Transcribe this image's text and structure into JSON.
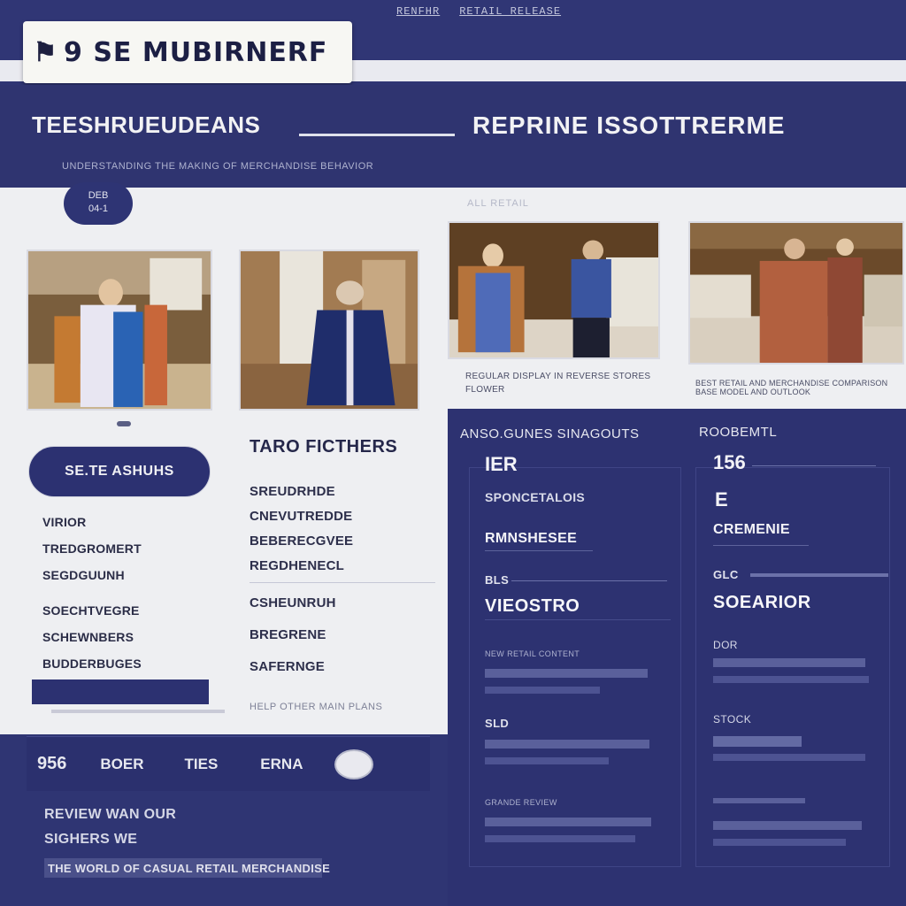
{
  "header": {
    "top_links": [
      "RENFHR",
      "RETAIL RELEASE"
    ],
    "logo_text": "9 SE MUBIRNERF"
  },
  "hero": {
    "title_left": "TEESHRUEUDEANS",
    "title_right": "REPRINE ISSOTTRERME",
    "subtitle": "UNDERSTANDING THE MAKING OF MERCHANDISE BEHAVIOR"
  },
  "date_badge": {
    "line1": "DEB",
    "line2": "04-1"
  },
  "panel_caption": "ALL RETAIL",
  "photos": [
    {
      "caption": ""
    },
    {
      "caption": ""
    },
    {
      "caption_line1": "REGULAR DISPLAY IN REVERSE STORES",
      "caption_line2": "FLOWER"
    },
    {
      "caption": "BEST RETAIL AND MERCHANDISE COMPARISON BASE MODEL AND OUTLOOK"
    }
  ],
  "left_card": {
    "button_label": "SE.TE ASHUHS",
    "items": [
      "VIRIOR",
      "TREDGROMERT",
      "SEGDGUUNH",
      "SOECHTVEGRE",
      "SCHEWNBERS",
      "BUDDERBUGES"
    ]
  },
  "mid_col": {
    "title": "TARO FICTHERS",
    "items": [
      "SREUDRHDE",
      "CNEVUTREDDE",
      "BEBERECGVEE",
      "REGDHENECL",
      "CSHEUNRUH",
      "BREGRENE",
      "SAFERNGE"
    ],
    "footer": "HELP OTHER MAIN PLANS"
  },
  "right_col_a": {
    "heading": "ANSO.GUNES SINAGOUTS",
    "big": "IER",
    "line1": "SPONCETALOIS",
    "line2": "RMNSHESEE",
    "tiny1": "BLS",
    "bold": "VIEOSTRO",
    "tiny2": "NEW RETAIL CONTENT",
    "tiny3": "SLD",
    "tiny4": "GRANDE REVIEW"
  },
  "right_col_b": {
    "heading": "ROOBEMTL",
    "big": "156",
    "big2": "E",
    "line1": "CREMENIE",
    "tiny1": "GLC",
    "bold": "SOEARIOR",
    "tiny2": "DOR",
    "tiny3": "STOCK"
  },
  "bottom_bar": {
    "items": [
      "956",
      "BOER",
      "TIES",
      "ERNA"
    ]
  },
  "footer": {
    "line1": "REVIEW WAN OUR",
    "line2": "SIGHERS WE",
    "line3": "THE WORLD OF CASUAL RETAIL MERCHANDISE"
  }
}
